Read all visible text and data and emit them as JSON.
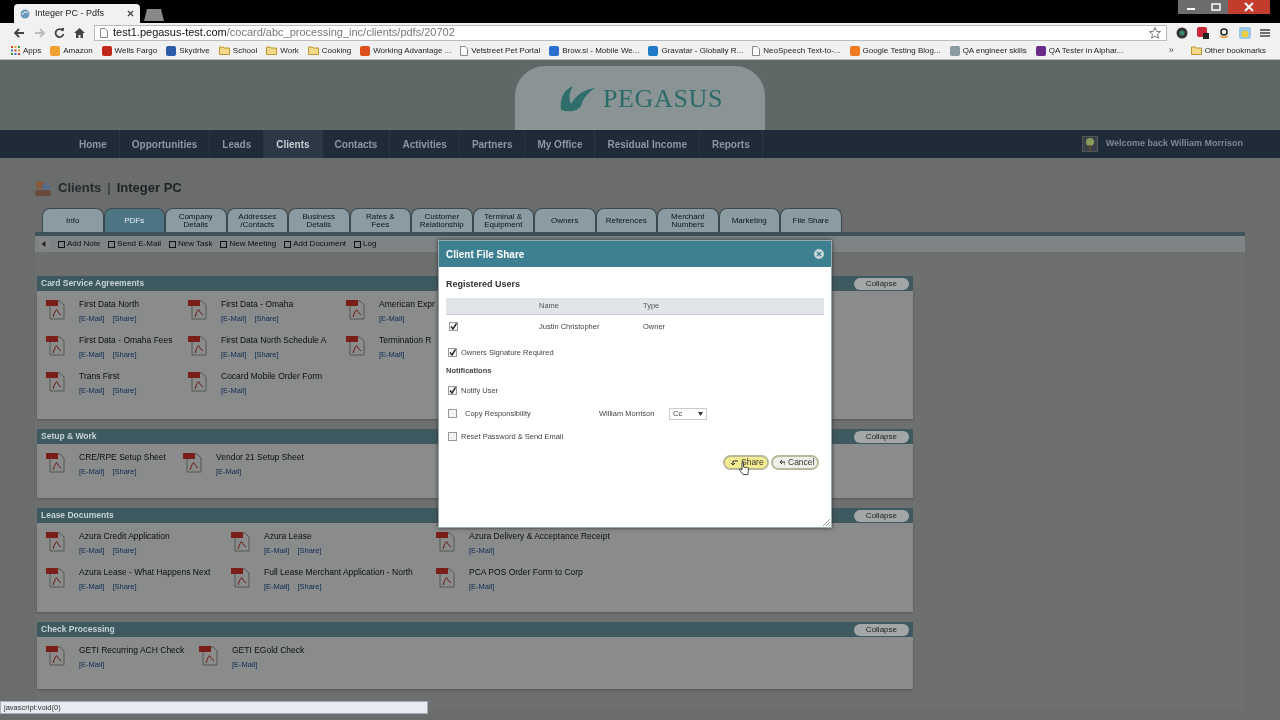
{
  "browser": {
    "tabs": [
      {
        "title": "Integer PC - Pdfs",
        "selected": true
      }
    ],
    "url_host": "test1.pegasus-test.com",
    "url_path": "/cocard/abc_processing_inc/clients/pdfs/20702",
    "bookmarks": [
      {
        "label": "Apps",
        "kind": "apps"
      },
      {
        "label": "Amazon",
        "kind": "site",
        "color": "#f0a030"
      },
      {
        "label": "Wells Fargo",
        "kind": "site",
        "color": "#c0281c"
      },
      {
        "label": "Skydrive",
        "kind": "site",
        "color": "#2a5caa"
      },
      {
        "label": "School",
        "kind": "folder"
      },
      {
        "label": "Work",
        "kind": "folder"
      },
      {
        "label": "Cooking",
        "kind": "folder"
      },
      {
        "label": "Working Advantage ...",
        "kind": "site",
        "color": "#e0501e"
      },
      {
        "label": "Vetstreet Pet Portal",
        "kind": "page"
      },
      {
        "label": "Brow.si - Mobile We...",
        "kind": "site",
        "color": "#2a6fd0"
      },
      {
        "label": "Gravatar - Globally R...",
        "kind": "site",
        "color": "#1e7ac8"
      },
      {
        "label": "NeoSpeech Text-to-...",
        "kind": "page"
      },
      {
        "label": "Google Testing Blog...",
        "kind": "site",
        "color": "#f07a20"
      },
      {
        "label": "QA engineer skills",
        "kind": "site",
        "color": "#8a9aa0"
      },
      {
        "label": "QA Tester in Alphar...",
        "kind": "site",
        "color": "#6a2a8a"
      }
    ],
    "overflow": "»",
    "other_bookmarks": "Other bookmarks"
  },
  "header": {
    "logo": "PEGASUS"
  },
  "nav": {
    "items": [
      {
        "label": "Home",
        "selected": false
      },
      {
        "label": "Opportunities",
        "selected": false
      },
      {
        "label": "Leads",
        "selected": false
      },
      {
        "label": "Clients",
        "selected": true
      },
      {
        "label": "Contacts",
        "selected": false
      },
      {
        "label": "Activities",
        "selected": false
      },
      {
        "label": "Partners",
        "selected": false
      },
      {
        "label": "My Office",
        "selected": false
      },
      {
        "label": "Residual Income",
        "selected": false
      },
      {
        "label": "Reports",
        "selected": false
      }
    ],
    "welcome": "Welcome back William Morrison"
  },
  "breadcrumb": {
    "section": "Clients",
    "separator": "|",
    "record": "Integer PC"
  },
  "tabs": [
    {
      "label": "Info",
      "selected": false
    },
    {
      "label": "PDFs",
      "selected": true
    },
    {
      "label": "Company\nDetails",
      "selected": false
    },
    {
      "label": "Addresses\n/Contacts",
      "selected": false
    },
    {
      "label": "Business\nDetails",
      "selected": false
    },
    {
      "label": "Rates &\nFees",
      "selected": false
    },
    {
      "label": "Customer\nRelationship",
      "selected": false
    },
    {
      "label": "Terminal &\nEquipment",
      "selected": false
    },
    {
      "label": "Owners",
      "selected": false
    },
    {
      "label": "References",
      "selected": false
    },
    {
      "label": "Merchant\nNumbers",
      "selected": false
    },
    {
      "label": "Marketing",
      "selected": false
    },
    {
      "label": "File Share",
      "selected": false
    }
  ],
  "actions": [
    "Add Note",
    "Send E-Mail",
    "New Task",
    "New Meeting",
    "Add Document",
    "Log"
  ],
  "sections": [
    {
      "title": "Card Service Agreements",
      "collapse": "Collapse",
      "items": [
        {
          "name": "First Data North",
          "links": [
            "[E-Mail]",
            "[Share]"
          ]
        },
        {
          "name": "First Data - Omaha",
          "links": [
            "[E-Mail]",
            "[Share]"
          ]
        },
        {
          "name": "American Expr",
          "links": [
            "[E-Mail]"
          ]
        },
        {
          "name": "First Data - Omaha Fees",
          "links": [
            "[E-Mail]",
            "[Share]"
          ]
        },
        {
          "name": "First Data North Schedule A",
          "links": [
            "[E-Mail]",
            "[Share]"
          ]
        },
        {
          "name": "Termination R",
          "links": [
            "[E-Mail]"
          ]
        },
        {
          "name": "Trans First",
          "links": [
            "[E-Mail]",
            "[Share]"
          ]
        },
        {
          "name": "Cocard Mobile Order Form",
          "links": [
            "[E-Mail]"
          ]
        }
      ]
    },
    {
      "title": "Setup & Work",
      "collapse": "Collapse",
      "items": [
        {
          "name": "CRE/RPE Setup Sheet",
          "links": [
            "[E-Mail]",
            "[Share]"
          ]
        },
        {
          "name": "Vendor 21 Setup Sheet",
          "links": [
            "[E-Mail]"
          ]
        }
      ]
    },
    {
      "title": "Lease Documents",
      "collapse": "Collapse",
      "items": [
        {
          "name": "Azura Credit Application",
          "links": [
            "[E-Mail]",
            "[Share]"
          ]
        },
        {
          "name": "Azura Lease",
          "links": [
            "[E-Mail]",
            "[Share]"
          ]
        },
        {
          "name": "Azura Delivery & Acceptance Receipt",
          "links": [
            "[E-Mail]"
          ]
        },
        {
          "name": "Azura Lease - What Happens Next",
          "links": [
            "[E-Mail]",
            "[Share]"
          ]
        },
        {
          "name": "Full Lease Merchant Application - North",
          "links": [
            "[E-Mail]",
            "[Share]"
          ]
        },
        {
          "name": "PCA POS Order Form to Corp",
          "links": [
            "[E-Mail]"
          ]
        }
      ]
    },
    {
      "title": "Check Processing",
      "collapse": "Collapse",
      "items": [
        {
          "name": "GETI Recurring ACH Check",
          "links": [
            "[E-Mail]"
          ]
        },
        {
          "name": "GETI EGold Check",
          "links": [
            "[E-Mail]"
          ]
        }
      ]
    }
  ],
  "modal": {
    "title": "Client File Share",
    "subtitle": "Registered Users",
    "columns": [
      "Name",
      "Type"
    ],
    "users": [
      {
        "checked": true,
        "name": "Justin Christopher",
        "type": "Owner"
      }
    ],
    "owners_signature": {
      "label": "Owners Signature Required",
      "checked": true
    },
    "notifications_heading": "Notifications",
    "options": [
      {
        "kind": "check",
        "label": "Notify User",
        "checked": true
      },
      {
        "kind": "copy",
        "label": "Copy Responsibility",
        "checked": false,
        "person": "William Morrison",
        "select": "Cc"
      },
      {
        "kind": "check",
        "label": "Reset Password & Send Email",
        "checked": false
      }
    ],
    "buttons": [
      {
        "kind": "share",
        "label": "Share"
      },
      {
        "kind": "cancel",
        "label": "Cancel"
      }
    ]
  },
  "status_bar": "javascript:void(0)"
}
